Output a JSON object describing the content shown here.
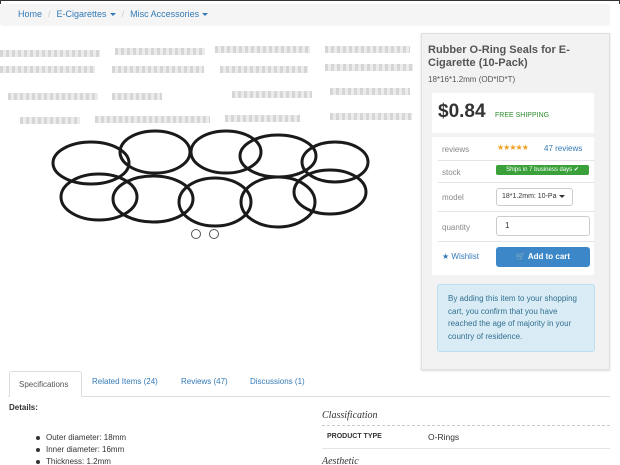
{
  "breadcrumb": {
    "items": [
      "Home",
      "E-Cigarettes",
      "Misc Accessories"
    ]
  },
  "product": {
    "title": "Rubber O-Ring Seals for E-Cigarette (10-Pack)",
    "subtitle": "18*16*1.2mm (OD*ID*T)",
    "price": "$0.84",
    "shipping": "FREE SHIPPING"
  },
  "attributes": {
    "reviews_label": "reviews",
    "rating_stars": 5,
    "reviews_link": "47 reviews",
    "stock_label": "stock",
    "stock_badge": "Ships in 7 business days ✔",
    "model_label": "model",
    "model_value": "18*1.2mm: 10-Pa",
    "quantity_label": "quantity",
    "quantity_value": "1",
    "wishlist": "Wishlist",
    "add_to_cart": "Add to cart"
  },
  "notice": "By adding this item to your shopping cart, you confirm that you have reached the age of majority in your country of residence.",
  "tabs": [
    "Specifications",
    "Related Items (24)",
    "Reviews (47)",
    "Discussions (1)"
  ],
  "details": {
    "label": "Details:",
    "specs": [
      "Outer diameter: 18mm",
      "Inner diameter: 16mm",
      "Thickness: 1.2mm"
    ]
  },
  "classification": {
    "heading": "Classification",
    "product_type_label": "PRODUCT TYPE",
    "product_type_value": "O-Rings",
    "aesthetic_heading": "Aesthetic"
  },
  "colors": {
    "link": "#337ab7",
    "cart_button": "#3b87c8",
    "stock_badge": "#3aa13a",
    "shipping_text": "#2e8b2e",
    "notice_bg": "#d9ecf6"
  }
}
